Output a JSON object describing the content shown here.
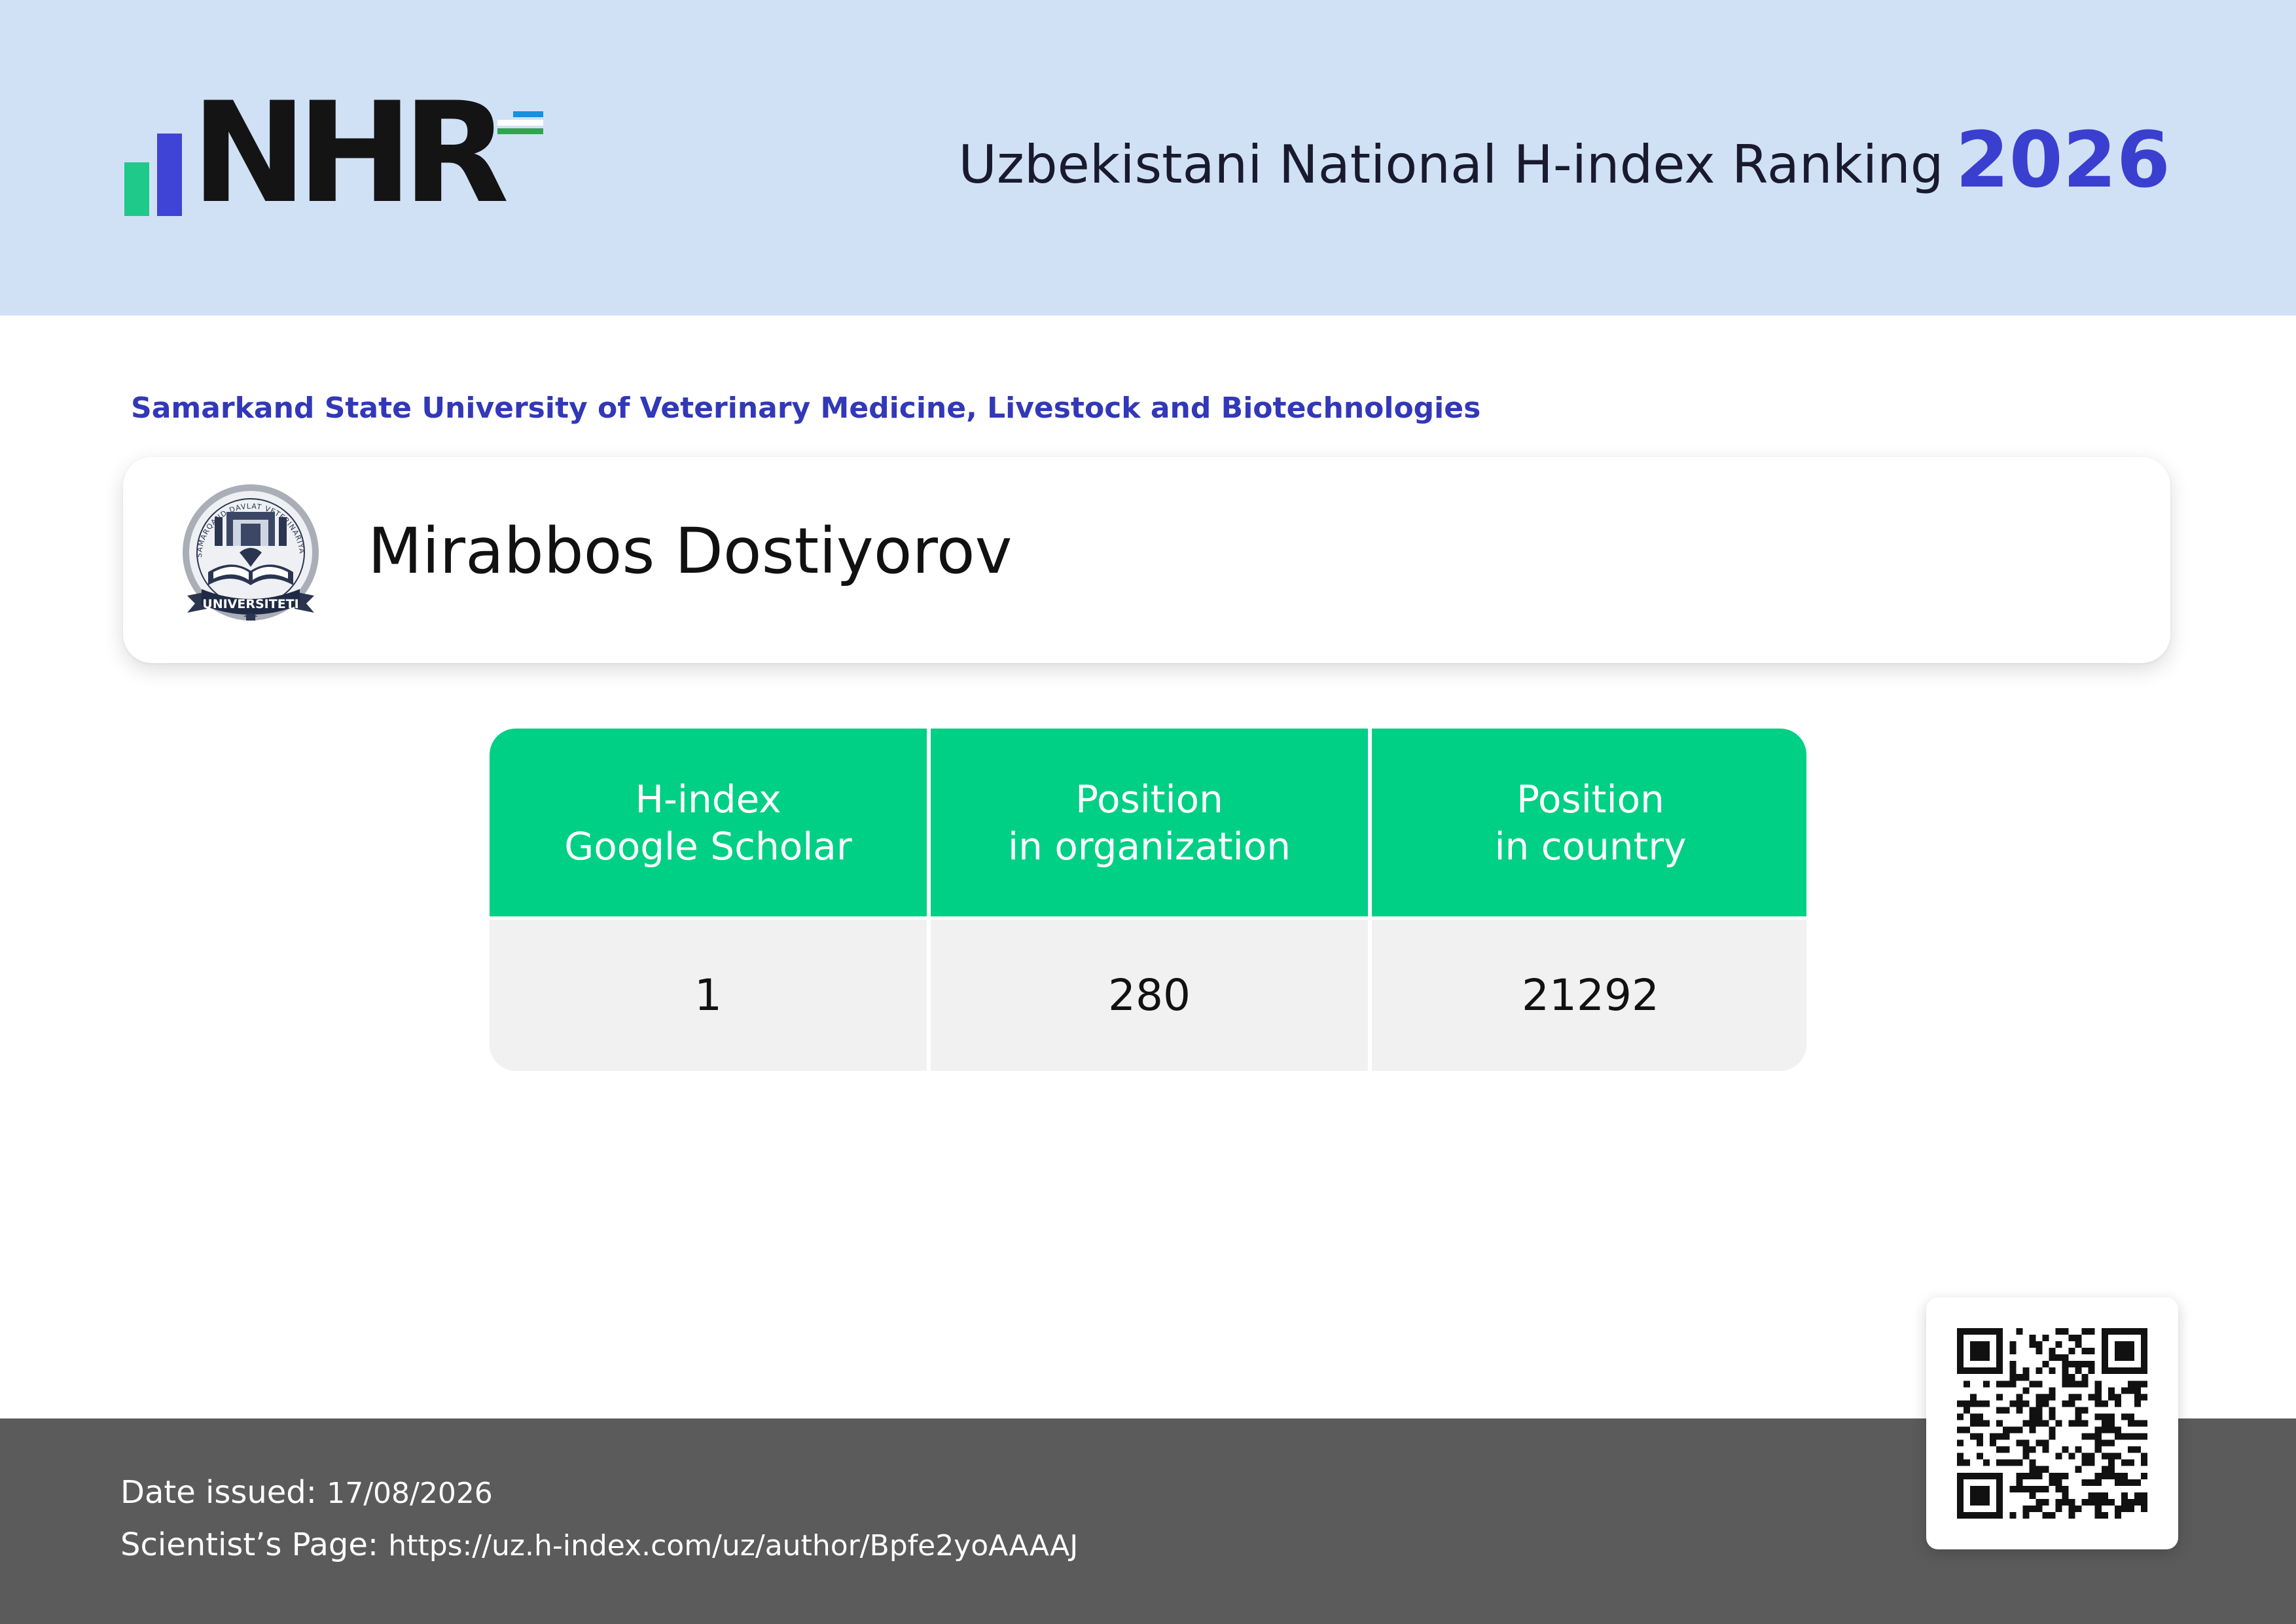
{
  "header": {
    "logo_text": "NHR",
    "title": "Uzbekistani National H-index Ranking",
    "year": "2026"
  },
  "organization": {
    "name": "Samarkand State University of Veterinary Medicine, Livestock and Biotechnologies",
    "emblem_icon": "university-emblem-icon",
    "emblem_text": "UNIVERSITETI"
  },
  "scientist": {
    "name": "Mirabbos Dostiyorov"
  },
  "stats": [
    {
      "label_line1": "H-index",
      "label_line2": "Google Scholar",
      "value": "1"
    },
    {
      "label_line1": "Position",
      "label_line2": "in organization",
      "value": "280"
    },
    {
      "label_line1": "Position",
      "label_line2": "in country",
      "value": "21292"
    }
  ],
  "footer": {
    "date_label": "Date issued:",
    "date_value": "17/08/2026",
    "page_label": "Scientist’s Page:",
    "page_url": "https://uz.h-index.com/uz/author/Bpfe2yoAAAAJ"
  },
  "colors": {
    "header_bg": "#d0e1f6",
    "accent_blue": "#3a3fd0",
    "accent_green": "#00cf86",
    "footer_bg": "#5b5b5b"
  }
}
